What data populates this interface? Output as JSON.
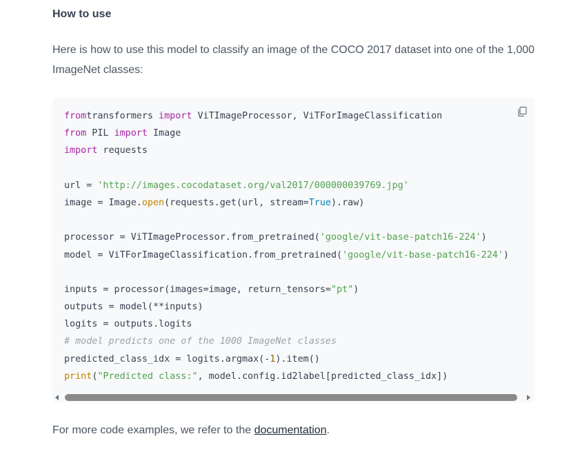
{
  "section": {
    "title": "How to use",
    "intro": "Here is how to use this model to classify an image of the COCO 2017 dataset into one of the 1,000 ImageNet classes:"
  },
  "code": {
    "copy_icon": "copy-icon",
    "lines": [
      [
        [
          "kw",
          "from"
        ],
        [
          "",
          "transformers"
        ],
        [
          "kw",
          " import"
        ],
        [
          "",
          " ViTImageProcessor, ViTForImageClassification"
        ]
      ],
      [
        [
          "kw",
          "from"
        ],
        [
          "",
          " PIL "
        ],
        [
          "kw",
          "import"
        ],
        [
          "",
          " Image"
        ]
      ],
      [
        [
          "kw",
          "import"
        ],
        [
          "",
          " requests"
        ]
      ],
      [],
      [
        [
          "",
          "url = "
        ],
        [
          "st",
          "'http://images.cocodataset.org/val2017/000000039769.jpg'"
        ]
      ],
      [
        [
          "",
          "image = Image."
        ],
        [
          "fn",
          "open"
        ],
        [
          "",
          "(requests.get(url, stream="
        ],
        [
          "bt",
          "True"
        ],
        [
          "",
          ").raw)"
        ]
      ],
      [],
      [
        [
          "",
          "processor = ViTImageProcessor.from_pretrained("
        ],
        [
          "st",
          "'google/vit-base-patch16-224'"
        ],
        [
          "",
          ")"
        ]
      ],
      [
        [
          "",
          "model = ViTForImageClassification.from_pretrained("
        ],
        [
          "st",
          "'google/vit-base-patch16-224'"
        ],
        [
          "",
          ")"
        ]
      ],
      [],
      [
        [
          "",
          "inputs = processor(images=image, return_tensors="
        ],
        [
          "st",
          "\"pt\""
        ],
        [
          "",
          ")"
        ]
      ],
      [
        [
          "",
          "outputs = model(**inputs)"
        ]
      ],
      [
        [
          "",
          "logits = outputs.logits"
        ]
      ],
      [
        [
          "cm",
          "# model predicts one of the 1000 ImageNet classes"
        ]
      ],
      [
        [
          "",
          "predicted_class_idx = logits.argmax(-"
        ],
        [
          "nm",
          "1"
        ],
        [
          "",
          ").item()"
        ]
      ],
      [
        [
          "fn",
          "print"
        ],
        [
          "",
          "("
        ],
        [
          "st",
          "\"Predicted class:\""
        ],
        [
          "",
          ", model.config.id2label[predicted_class_idx])"
        ]
      ]
    ]
  },
  "footer": {
    "prefix": "For more code examples, we refer to the ",
    "link_label": "documentation",
    "suffix": "."
  }
}
